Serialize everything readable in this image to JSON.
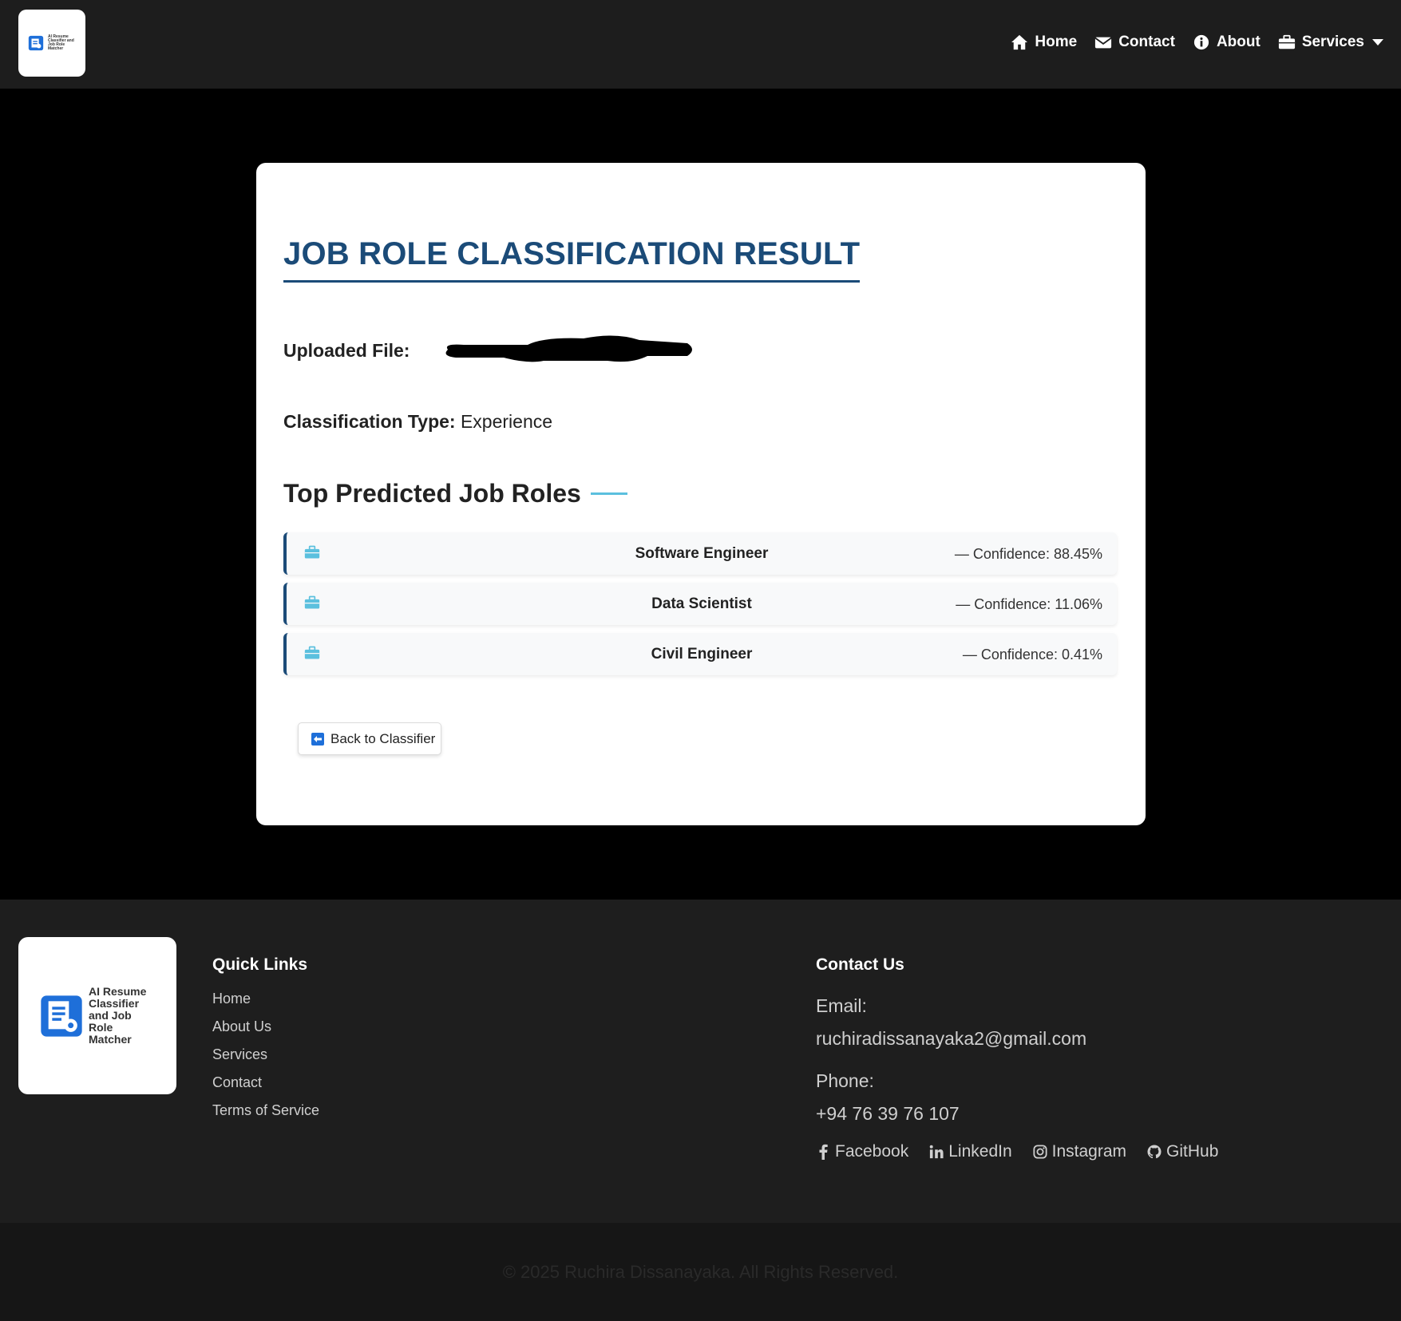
{
  "navbar": {
    "logo_alt_text": "AI Resume Classifier and Job Role Matcher",
    "items": [
      {
        "label": "Home",
        "icon": "home-icon"
      },
      {
        "label": "Contact",
        "icon": "envelope-icon"
      },
      {
        "label": "About",
        "icon": "info-icon"
      },
      {
        "label": "Services",
        "icon": "briefcase-icon"
      }
    ]
  },
  "result": {
    "title": "JOB ROLE CLASSIFICATION RESULT",
    "uploaded_file_label": "Uploaded File:",
    "uploaded_file_value": "[redacted]",
    "classification_type_label": "Classification Type:",
    "classification_type_value": "Experience",
    "top_roles_heading": "Top Predicted Job Roles",
    "roles": [
      {
        "name": "Software Engineer",
        "confidence": "— Confidence: 88.45%"
      },
      {
        "name": "Data Scientist",
        "confidence": "— Confidence: 11.06%"
      },
      {
        "name": "Civil Engineer",
        "confidence": "— Confidence: 0.41%"
      }
    ],
    "back_button_label": "Back to Classifier"
  },
  "footer": {
    "logo_text": "AI Resume Classifier and Job Role Matcher",
    "quick_links_heading": "Quick Links",
    "quick_links": [
      "Home",
      "About Us",
      "Services",
      "Contact",
      "Terms of Service"
    ],
    "contact_heading": "Contact Us",
    "email_label": "Email:",
    "email_value": "ruchiradissanayaka2@gmail.com",
    "phone_label": "Phone:",
    "phone_value": "+94 76 39 76 107",
    "social": [
      {
        "label": "Facebook",
        "icon": "facebook-icon"
      },
      {
        "label": "LinkedIn",
        "icon": "linkedin-icon"
      },
      {
        "label": "Instagram",
        "icon": "instagram-icon"
      },
      {
        "label": "GitHub",
        "icon": "github-icon"
      }
    ],
    "copyright": "© 2025 Ruchira Dissanayaka. All Rights Reserved."
  },
  "colors": {
    "accent": "#1b4b78",
    "icon_blue": "#5bc0de",
    "navbar_bg": "#1d1d1d",
    "footer_bg": "#1e1e1e"
  }
}
